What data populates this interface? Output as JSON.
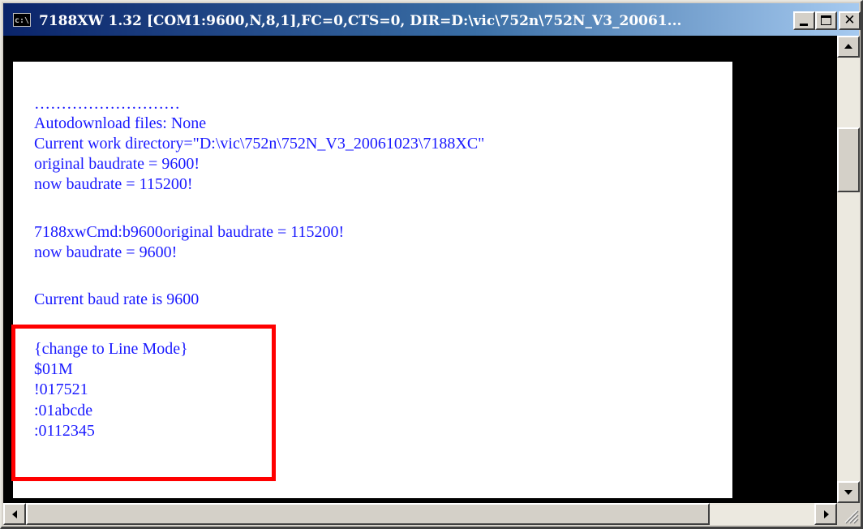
{
  "window": {
    "title": "7188XW 1.32 [COM1:9600,N,8,1],FC=0,CTS=0, DIR=D:\\vic\\752n\\752N_V3_20061...",
    "icon_text": "c:\\"
  },
  "console": {
    "lines": [
      "………………………",
      "Autodownload files: None",
      "Current work directory=\"D:\\vic\\752n\\752N_V3_20061023\\7188XC\"",
      "original baudrate = 9600!",
      "now baudrate = 115200!",
      "7188xwCmd:b9600original baudrate = 115200!",
      "now baudrate = 9600!",
      "Current baud rate is 9600",
      "{change to Line Mode}",
      "$01M",
      "!017521",
      ":01abcde",
      ":0112345"
    ]
  },
  "colors": {
    "text": "#1a1aff",
    "highlight_border": "#ff0000",
    "console_bg": "#000000",
    "output_bg": "#ffffff"
  },
  "icons": {
    "minimize": "minimize-icon",
    "maximize": "maximize-icon",
    "close": "close-icon",
    "scroll_up": "arrow-up-icon",
    "scroll_down": "arrow-down-icon",
    "scroll_left": "arrow-left-icon",
    "scroll_right": "arrow-right-icon",
    "resize_grip": "resize-grip-icon"
  }
}
